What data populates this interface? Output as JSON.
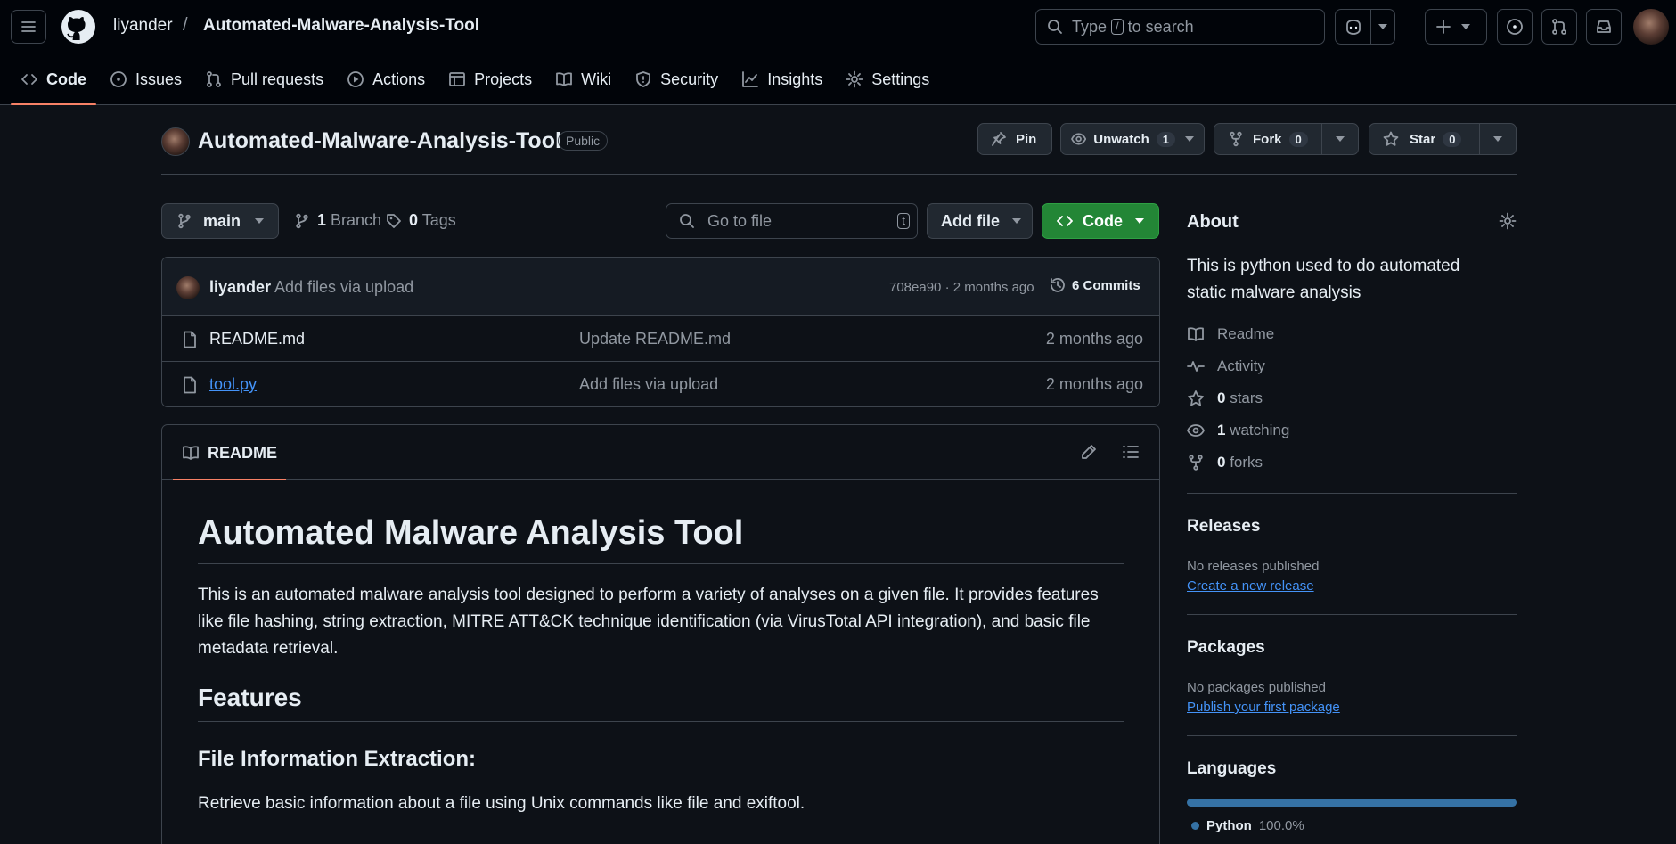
{
  "header": {
    "owner": "liyander",
    "separator": "/",
    "repo": "Automated-Malware-Analysis-Tool",
    "search_prefix": "Type",
    "search_key": "/",
    "search_suffix": "to search"
  },
  "nav": {
    "tabs": [
      {
        "label": "Code",
        "icon": "code-icon",
        "active": true
      },
      {
        "label": "Issues",
        "icon": "issue-icon"
      },
      {
        "label": "Pull requests",
        "icon": "pull-request-icon"
      },
      {
        "label": "Actions",
        "icon": "play-icon"
      },
      {
        "label": "Projects",
        "icon": "table-icon"
      },
      {
        "label": "Wiki",
        "icon": "book-icon"
      },
      {
        "label": "Security",
        "icon": "shield-icon"
      },
      {
        "label": "Insights",
        "icon": "graph-icon"
      },
      {
        "label": "Settings",
        "icon": "gear-icon"
      }
    ]
  },
  "repohead": {
    "title": "Automated-Malware-Analysis-Tool",
    "visibility": "Public",
    "pin_label": "Pin",
    "watch_label": "Unwatch",
    "watch_count": "1",
    "fork_label": "Fork",
    "fork_count": "0",
    "star_label": "Star",
    "star_count": "0"
  },
  "branchbar": {
    "branch": "main",
    "branch_count": "1",
    "branch_word": "Branch",
    "tag_count": "0",
    "tag_word": "Tags",
    "goto_placeholder": "Go to file",
    "goto_key": "t",
    "add_file": "Add file",
    "code": "Code"
  },
  "commit": {
    "author": "liyander",
    "message": "Add files via upload",
    "sha_time": "708ea90 · 2 months ago",
    "commits": "6 Commits"
  },
  "files": [
    {
      "name": "README.md",
      "message": "Update README.md",
      "age": "2 months ago",
      "link": false
    },
    {
      "name": "tool.py",
      "message": "Add files via upload",
      "age": "2 months ago",
      "link": true
    }
  ],
  "readme": {
    "tab": "README",
    "h1": "Automated Malware Analysis Tool",
    "p1": "This is an automated malware analysis tool designed to perform a variety of analyses on a given file. It provides features like file hashing, string extraction, MITRE ATT&CK technique identification (via VirusTotal API integration), and basic file metadata retrieval.",
    "h2": "Features",
    "h3": "File Information Extraction:",
    "p2": "Retrieve basic information about a file using Unix commands like file and exiftool."
  },
  "about": {
    "title": "About",
    "description": "This is python used to do automated static malware analysis",
    "readme": "Readme",
    "activity": "Activity",
    "stars_count": "0",
    "stars_word": "stars",
    "watching_count": "1",
    "watching_word": "watching",
    "forks_count": "0",
    "forks_word": "forks"
  },
  "releases": {
    "title": "Releases",
    "note": "No releases published",
    "link": "Create a new release"
  },
  "packages": {
    "title": "Packages",
    "note": "No packages published",
    "link": "Publish your first package"
  },
  "languages": {
    "title": "Languages",
    "name": "Python",
    "percent": "100.0%",
    "color": "#3572a5"
  },
  "colors": {
    "background": "#0d1117",
    "header": "#010409",
    "border": "#3d444d",
    "accent_tab": "#f78166",
    "code_button": "#238636",
    "link": "#4493f8"
  }
}
